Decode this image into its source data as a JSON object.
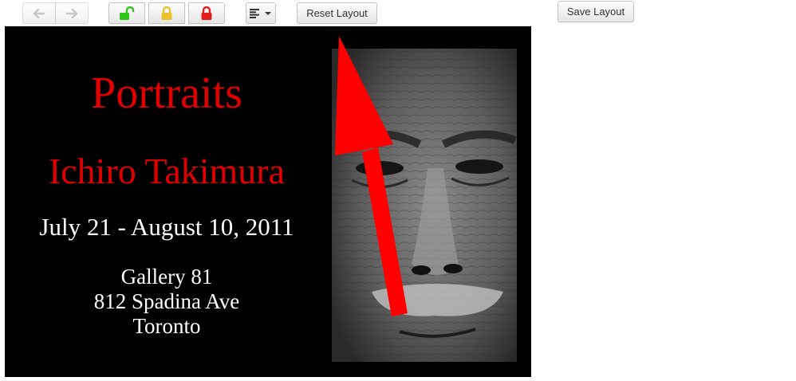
{
  "toolbar": {
    "back_icon": "arrow-left-icon",
    "forward_icon": "arrow-right-icon",
    "unlock_icon": "unlocked-padlock-icon",
    "lock_partial_icon": "padlock-icon",
    "lock_icon": "padlock-icon",
    "align_icon": "align-left-icon",
    "reset_label": "Reset Layout",
    "save_label": "Save Layout",
    "colors": {
      "unlock": "#2fc419",
      "lock_partial": "#e8c12c",
      "lock": "#e21b1b"
    }
  },
  "poster": {
    "title": "Portraits",
    "artist": "Ichiro Takimura",
    "dates": "July 21 - August 10, 2011",
    "address": [
      "Gallery 81",
      "812 Spadina Ave",
      "Toronto"
    ],
    "colors": {
      "background": "#000000",
      "headline": "#e10000",
      "body": "#ffffff",
      "arrow": "#ff0000"
    }
  }
}
